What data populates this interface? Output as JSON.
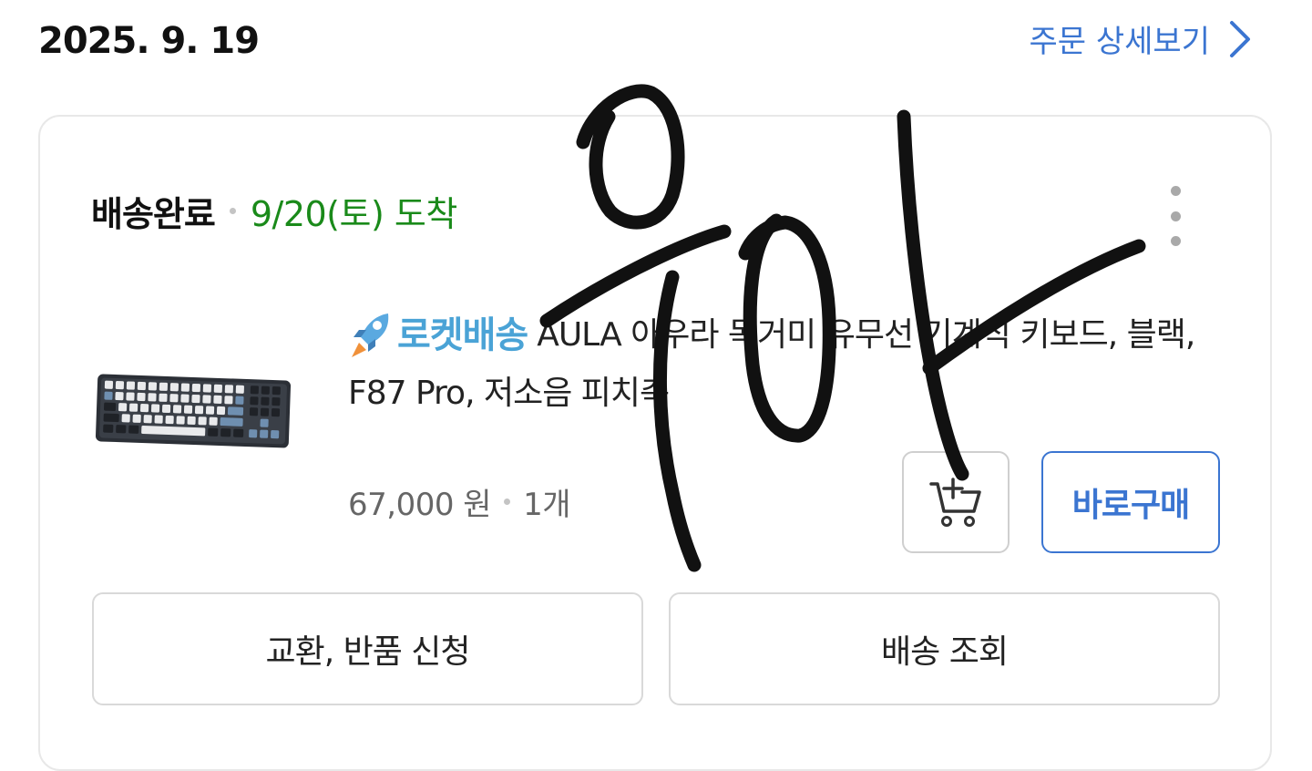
{
  "order": {
    "date": "2025. 9. 19",
    "detail_link_label": "주문 상세보기"
  },
  "delivery": {
    "status": "배송완료",
    "arrival": "9/20(토) 도착"
  },
  "product": {
    "badge_label": "로켓배송",
    "title": "AULA 아우라 독거미 유무선 기계식 키보드, 블랙, F87 Pro, 저소음 피치축",
    "price": "67,000 원",
    "quantity": "1개"
  },
  "buttons": {
    "buy_now": "바로구매",
    "exchange_return": "교환, 반품 신청",
    "delivery_track": "배송 조회"
  },
  "handwriting": {
    "text": "우아"
  },
  "colors": {
    "link_blue": "#3b75d1",
    "arrival_green": "#1a8a1a",
    "rocket_blue": "#4aa3d6"
  },
  "icons": [
    "chevron-right-icon",
    "more-vertical-icon",
    "rocket-icon",
    "cart-plus-icon"
  ]
}
